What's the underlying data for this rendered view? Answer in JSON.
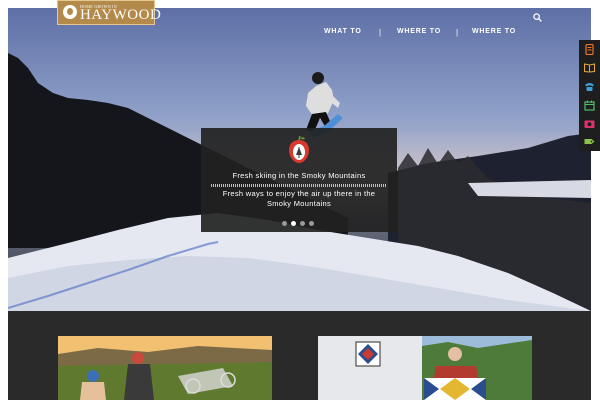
{
  "logo": {
    "small_text": "HOME GROWN IN",
    "big_text": "HAYWOOD",
    "brand_color": "#b48a4a"
  },
  "nav": {
    "items": [
      {
        "label": "WHAT TO"
      },
      {
        "label": "WHERE TO"
      },
      {
        "label": "WHERE TO"
      }
    ],
    "separator": "|",
    "search_icon": "search-icon"
  },
  "side_bar": {
    "icons": [
      {
        "name": "phone-book-icon",
        "color": "#e8752a"
      },
      {
        "name": "book-icon",
        "color": "#e0a93a"
      },
      {
        "name": "phone-icon",
        "color": "#3aa0d8"
      },
      {
        "name": "calendar-icon",
        "color": "#4bbf6a"
      },
      {
        "name": "camera-icon",
        "color": "#e0326e"
      },
      {
        "name": "ticket-icon",
        "color": "#8bc34a"
      }
    ]
  },
  "slider": {
    "caption_title": "Fresh skiing in the Smoky Mountains",
    "caption_subtitle": "Fresh ways to enjoy the air up there in the Smoky Mountains",
    "dots_total": 4,
    "active_dot": 2
  },
  "cards": [
    {
      "name": "cycling-photo"
    },
    {
      "name": "quilt-barn-photo"
    }
  ]
}
